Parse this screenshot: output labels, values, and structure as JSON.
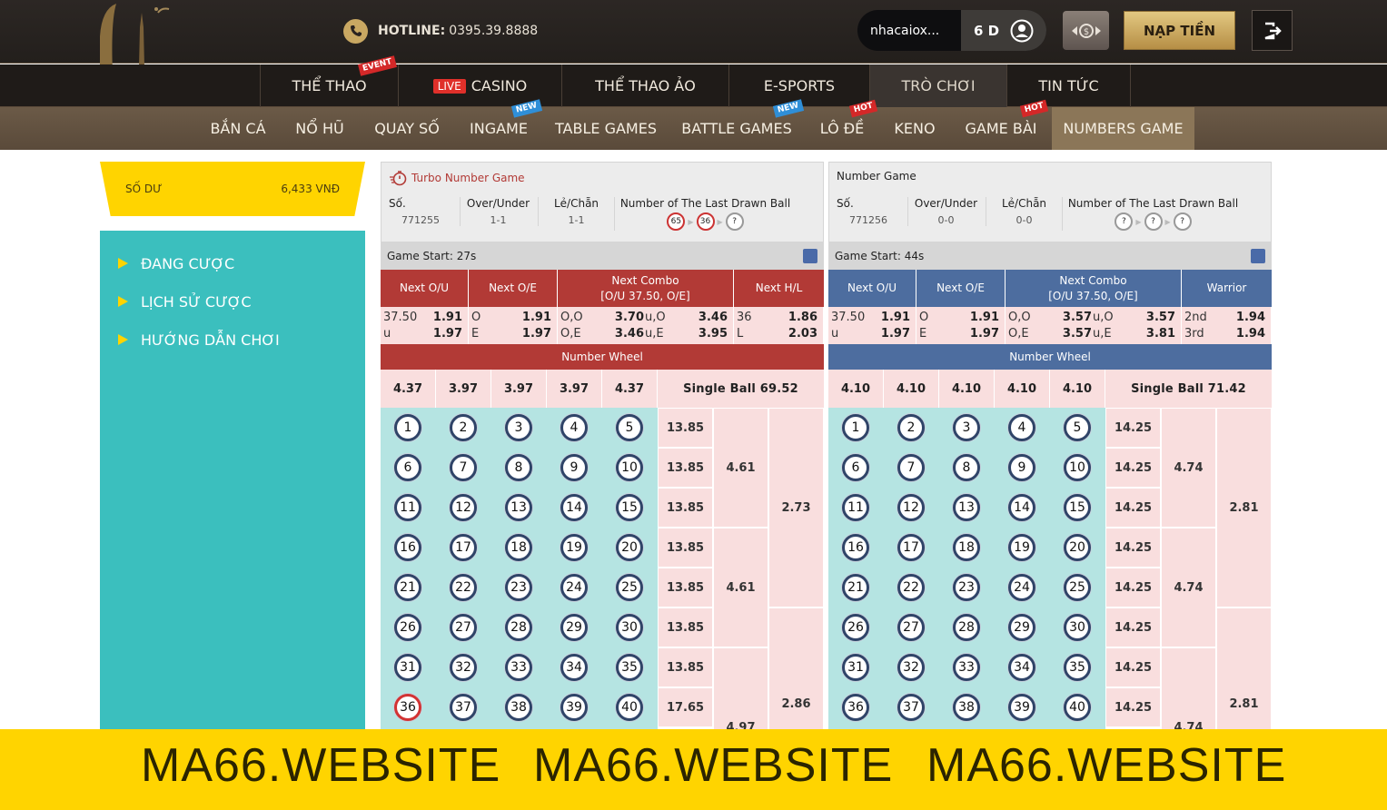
{
  "header": {
    "hotline_label": "HOTLINE:",
    "hotline_number": "0395.39.8888",
    "username": "nhacaiox...",
    "days": "6 D",
    "deposit_label": "NẠP TIỀN"
  },
  "nav_main": [
    {
      "label": "THỂ THAO",
      "tag": "EVENT"
    },
    {
      "label": "CASINO",
      "tag": "LIVE"
    },
    {
      "label": "THỂ THAO ẢO"
    },
    {
      "label": "E-SPORTS"
    },
    {
      "label": "TRÒ CHƠI"
    },
    {
      "label": "TIN TỨC"
    }
  ],
  "nav_sub": [
    {
      "label": "BẮN CÁ"
    },
    {
      "label": "NỔ HŨ"
    },
    {
      "label": "QUAY SỐ"
    },
    {
      "label": "INGAME",
      "tag": "NEW"
    },
    {
      "label": "TABLE GAMES"
    },
    {
      "label": "BATTLE GAMES",
      "tag": "NEW"
    },
    {
      "label": "LÔ ĐỀ",
      "tag": "HOT"
    },
    {
      "label": "KENO"
    },
    {
      "label": "GAME BÀI",
      "tag": "HOT"
    },
    {
      "label": "NUMBERS GAME"
    }
  ],
  "sidebar": {
    "balance_label": "SỐ DƯ",
    "balance_value": "6,433 VNĐ",
    "menu": [
      "ĐANG CƯỢC",
      "LỊCH SỬ CƯỢC",
      "HƯỚNG DẪN CHƠI"
    ]
  },
  "panels": [
    {
      "title": "Turbo Number Game",
      "col_so": "Số.",
      "col_ou": "Over/Under",
      "col_le": "Lẻ/Chẵn",
      "col_last": "Number of The Last Drawn Ball",
      "so_value": "771255",
      "ou_value": "1-1",
      "le_value": "1-1",
      "last_balls": [
        "65",
        "36",
        "?"
      ],
      "game_start": "Game Start: 27s",
      "headers": [
        "Next O/U",
        "Next O/E",
        "Next Combo",
        "[O/U 37.50, O/E]",
        "Next H/L"
      ],
      "ou": [
        [
          "37.50",
          "1.91"
        ],
        [
          "u",
          "1.97"
        ]
      ],
      "oe": [
        [
          "O",
          "1.91"
        ],
        [
          "E",
          "1.97"
        ]
      ],
      "combo": [
        [
          "O,O",
          "3.70",
          "u,O",
          "3.46"
        ],
        [
          "O,E",
          "3.46",
          "u,E",
          "3.95"
        ]
      ],
      "last": [
        [
          "36",
          "1.86"
        ],
        [
          "L",
          "2.03"
        ]
      ],
      "wheel_label": "Number Wheel",
      "wheel_values": [
        "4.37",
        "3.97",
        "3.97",
        "3.97",
        "4.37"
      ],
      "single_ball": "Single Ball  69.52",
      "row_odds": [
        "13.85",
        "13.85",
        "13.85",
        "13.85",
        "13.85",
        "13.85",
        "13.85",
        "17.65"
      ],
      "group_odds": [
        "4.61",
        "4.61",
        "4.97"
      ],
      "big_odds": [
        "2.73",
        "2.86"
      ],
      "red_ball": 36
    },
    {
      "title": "Number Game",
      "col_so": "Số.",
      "col_ou": "Over/Under",
      "col_le": "Lẻ/Chẵn",
      "col_last": "Number of The Last Drawn Ball",
      "so_value": "771256",
      "ou_value": "0-0",
      "le_value": "0-0",
      "last_balls": [
        "?",
        "?",
        "?"
      ],
      "game_start": "Game Start: 44s",
      "headers": [
        "Next O/U",
        "Next O/E",
        "Next Combo",
        "[O/U 37.50, O/E]",
        "Warrior"
      ],
      "ou": [
        [
          "37.50",
          "1.91"
        ],
        [
          "u",
          "1.97"
        ]
      ],
      "oe": [
        [
          "O",
          "1.91"
        ],
        [
          "E",
          "1.97"
        ]
      ],
      "combo": [
        [
          "O,O",
          "3.57",
          "u,O",
          "3.57"
        ],
        [
          "O,E",
          "3.57",
          "u,E",
          "3.81"
        ]
      ],
      "last": [
        [
          "2nd",
          "1.94"
        ],
        [
          "3rd",
          "1.94"
        ]
      ],
      "wheel_label": "Number Wheel",
      "wheel_values": [
        "4.10",
        "4.10",
        "4.10",
        "4.10",
        "4.10"
      ],
      "single_ball": "Single Ball  71.42",
      "row_odds": [
        "14.25",
        "14.25",
        "14.25",
        "14.25",
        "14.25",
        "14.25",
        "14.25",
        "14.25"
      ],
      "group_odds": [
        "4.74",
        "4.74",
        "4.74"
      ],
      "big_odds": [
        "2.81",
        "2.81"
      ],
      "red_ball": 0
    }
  ],
  "banner": [
    "MA66.WEBSITE",
    "MA66.WEBSITE",
    "MA66.WEBSITE"
  ],
  "colors": {
    "turbo_accent": "#b23a36",
    "normal_accent": "#4d6d9f",
    "balance_yellow": "#ffd400",
    "sidebar_teal": "#3bbfbe"
  }
}
